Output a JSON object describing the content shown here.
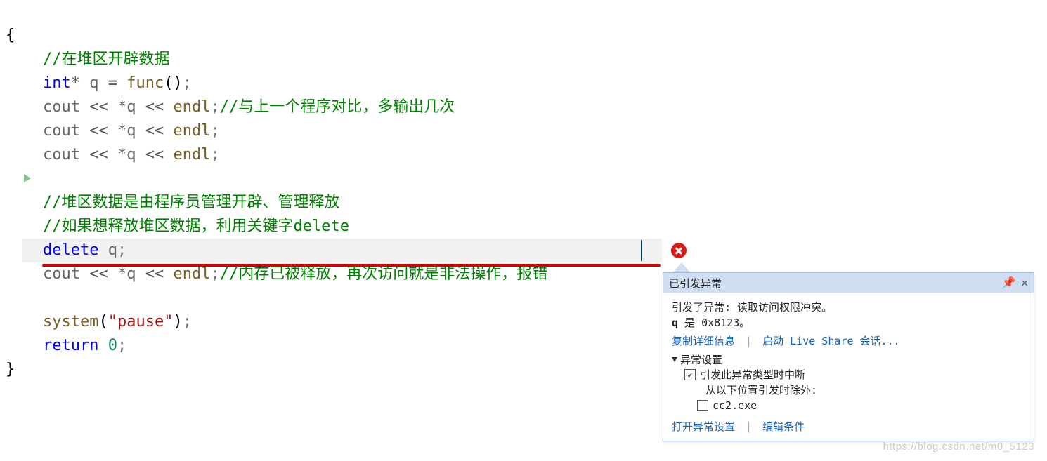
{
  "code": {
    "l0": "{",
    "l1_comment": "//在堆区开辟数据",
    "l2_kw_int": "int",
    "l2_star": "*",
    "l2_var": "q",
    "l2_eq": "=",
    "l2_func": "func",
    "l2_paren": "()",
    "l2_semi": ";",
    "cout": "cout",
    "op_ins": "<<",
    "deref_q": "*q",
    "endl": "endl",
    "semi": ";",
    "l3_comment": "//与上一个程序对比，多输出几次",
    "l7_comment": "//堆区数据是由程序员管理开辟、管理释放",
    "l8_comment": "//如果想释放堆区数据，利用关键字delete",
    "l9_delete": "delete",
    "l9_var": "q",
    "l10_comment": "//内存已被释放，再次访问就是非法操作，报错",
    "l12_system": "system",
    "l12_arg_open": "(",
    "l12_arg_str": "\"pause\"",
    "l12_arg_close": ")",
    "l13_return": "return",
    "l13_zero": "0",
    "l14": "}"
  },
  "popup": {
    "title": "已引发异常",
    "msg1": "引发了异常: 读取访问权限冲突。",
    "msg2_prefix": "q",
    "msg2_rest": " 是 0x8123。",
    "link_copy": "复制详细信息",
    "link_liveshare": "启动 Live Share 会话...",
    "section_title": "异常设置",
    "cb1_label": "引发此异常类型时中断",
    "exclude_label": "从以下位置引发时除外:",
    "cb2_label": "cc2.exe",
    "link_open": "打开异常设置",
    "link_edit": "编辑条件"
  },
  "watermark": "https://blog.csdn.net/m0_5123"
}
